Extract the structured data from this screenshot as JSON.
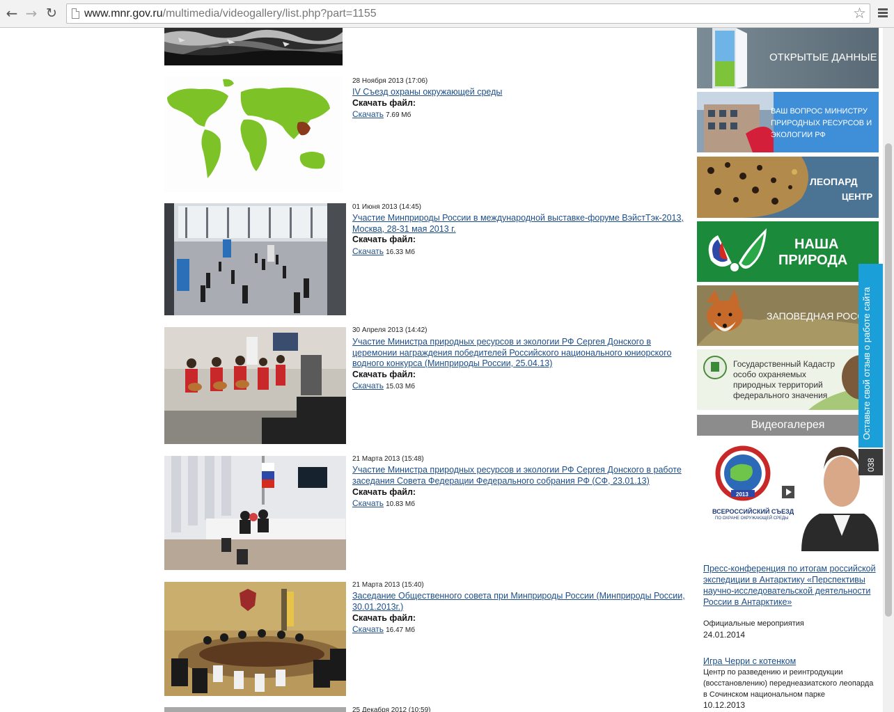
{
  "browser": {
    "url_host": "www.mnr.gov.ru",
    "url_path": "/multimedia/videogallery/list.php?part=1155"
  },
  "videos": [
    {
      "date": "28 Ноября 2013 (17:06)",
      "title": "IV Съезд охраны окружающей среды",
      "download_label": "Скачать файл:",
      "download_link": "Скачать",
      "size": "7.69 Мб"
    },
    {
      "date": "01 Июня 2013 (14:45)",
      "title": "Участие Минприроды России в международной выставке-форуме ВэйстТэк-2013, Москва, 28-31 мая 2013 г.",
      "download_label": "Скачать файл:",
      "download_link": "Скачать",
      "size": "16.33 Мб"
    },
    {
      "date": "30 Апреля 2013 (14:42)",
      "title": "Участие Министра природных ресурсов и экологии РФ Сергея Донского в церемонии награждения победителей Российского национального юниорского водного конкурса (Минприроды России, 25.04.13)",
      "download_label": "Скачать файл:",
      "download_link": "Скачать",
      "size": "15.03 Мб"
    },
    {
      "date": "21 Марта 2013 (15:48)",
      "title": "Участие Министра природных ресурсов и экологии РФ Сергея Донского в работе заседания Совета Федерации Федерального собрания РФ (СФ, 23.01.13)",
      "download_label": "Скачать файл:",
      "download_link": "Скачать",
      "size": "10.83 Мб"
    },
    {
      "date": "21 Марта 2013 (15:40)",
      "title": "Заседание Общественного совета при Минприроды России (Минприроды России, 30.01.2013г.)",
      "download_label": "Скачать файл:",
      "download_link": "Скачать",
      "size": "16.47 Мб"
    },
    {
      "date": "25 Декабря 2012 (10:59)"
    }
  ],
  "sidebar": {
    "banners": {
      "open_data": "ОТКРЫТЫЕ ДАННЫЕ",
      "question_line1": "ВАШ ВОПРОС МИНИСТРУ",
      "question_line2": "ПРИРОДНЫХ РЕСУРСОВ И",
      "question_line3": "ЭКОЛОГИИ РФ",
      "leopard_line1": "ЛЕОПАРД",
      "leopard_line2": "ЦЕНТР",
      "nasha_line1": "НАША",
      "nasha_line2": "ПРИРОДА",
      "zapoved": "ЗАПОВЕДНАЯ РОСС",
      "cadastre_line1": "Государственный Кадастр",
      "cadastre_line2": "особо охраняемых",
      "cadastre_line3": "природных территорий",
      "cadastre_line4": "федерального значения"
    },
    "videogallery_title": "Видеогалерея",
    "featured": {
      "badge_year": "2013",
      "caption_line1": "ВСЕРОССИЙСКИЙ СЪЕЗД",
      "caption_line2": "ПО ОХРАНЕ ОКРУЖАЮЩЕЙ СРЕДЫ"
    },
    "news": [
      {
        "title": "Пресс-конференция по итогам российской экспедиции в Антарктику «Перспективы научно-исследовательской деятельности России в Антарктике»",
        "category": "Официальные мероприятия",
        "date": "24.01.2014"
      },
      {
        "title": "Игра Черри с котенком",
        "category": "Центр по разведению и реинтродукции (восстановлению) переднеазиатского леопарда в Сочинском национальном парке",
        "date": "10.12.2013"
      }
    ],
    "feedback": {
      "label": "Оставьте свой отзыв о работе сайта",
      "count": "038"
    }
  }
}
